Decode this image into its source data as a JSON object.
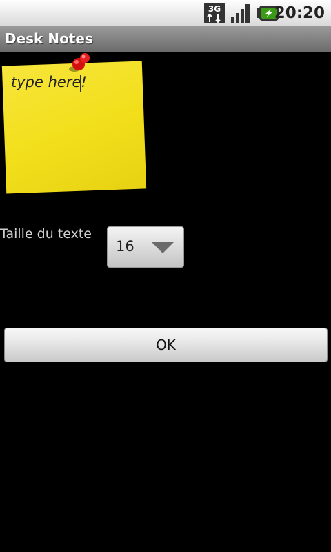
{
  "status_bar": {
    "network_label": "3G",
    "network_icon": "3g-data-icon",
    "signal_icon": "signal-strength-icon",
    "battery_icon": "battery-charging-icon",
    "battery_color": "#3b9a16",
    "time": "20:20"
  },
  "app_bar": {
    "title": "Desk Notes"
  },
  "note": {
    "text": "type here!",
    "note_color": "#f2df1a",
    "pin_icon": "push-pin-icon",
    "pin_color": "#e01010"
  },
  "settings": {
    "text_size_label": "Taille du texte",
    "text_size_value": "16",
    "dropdown_icon": "chevron-down-icon"
  },
  "actions": {
    "ok_label": "OK"
  }
}
